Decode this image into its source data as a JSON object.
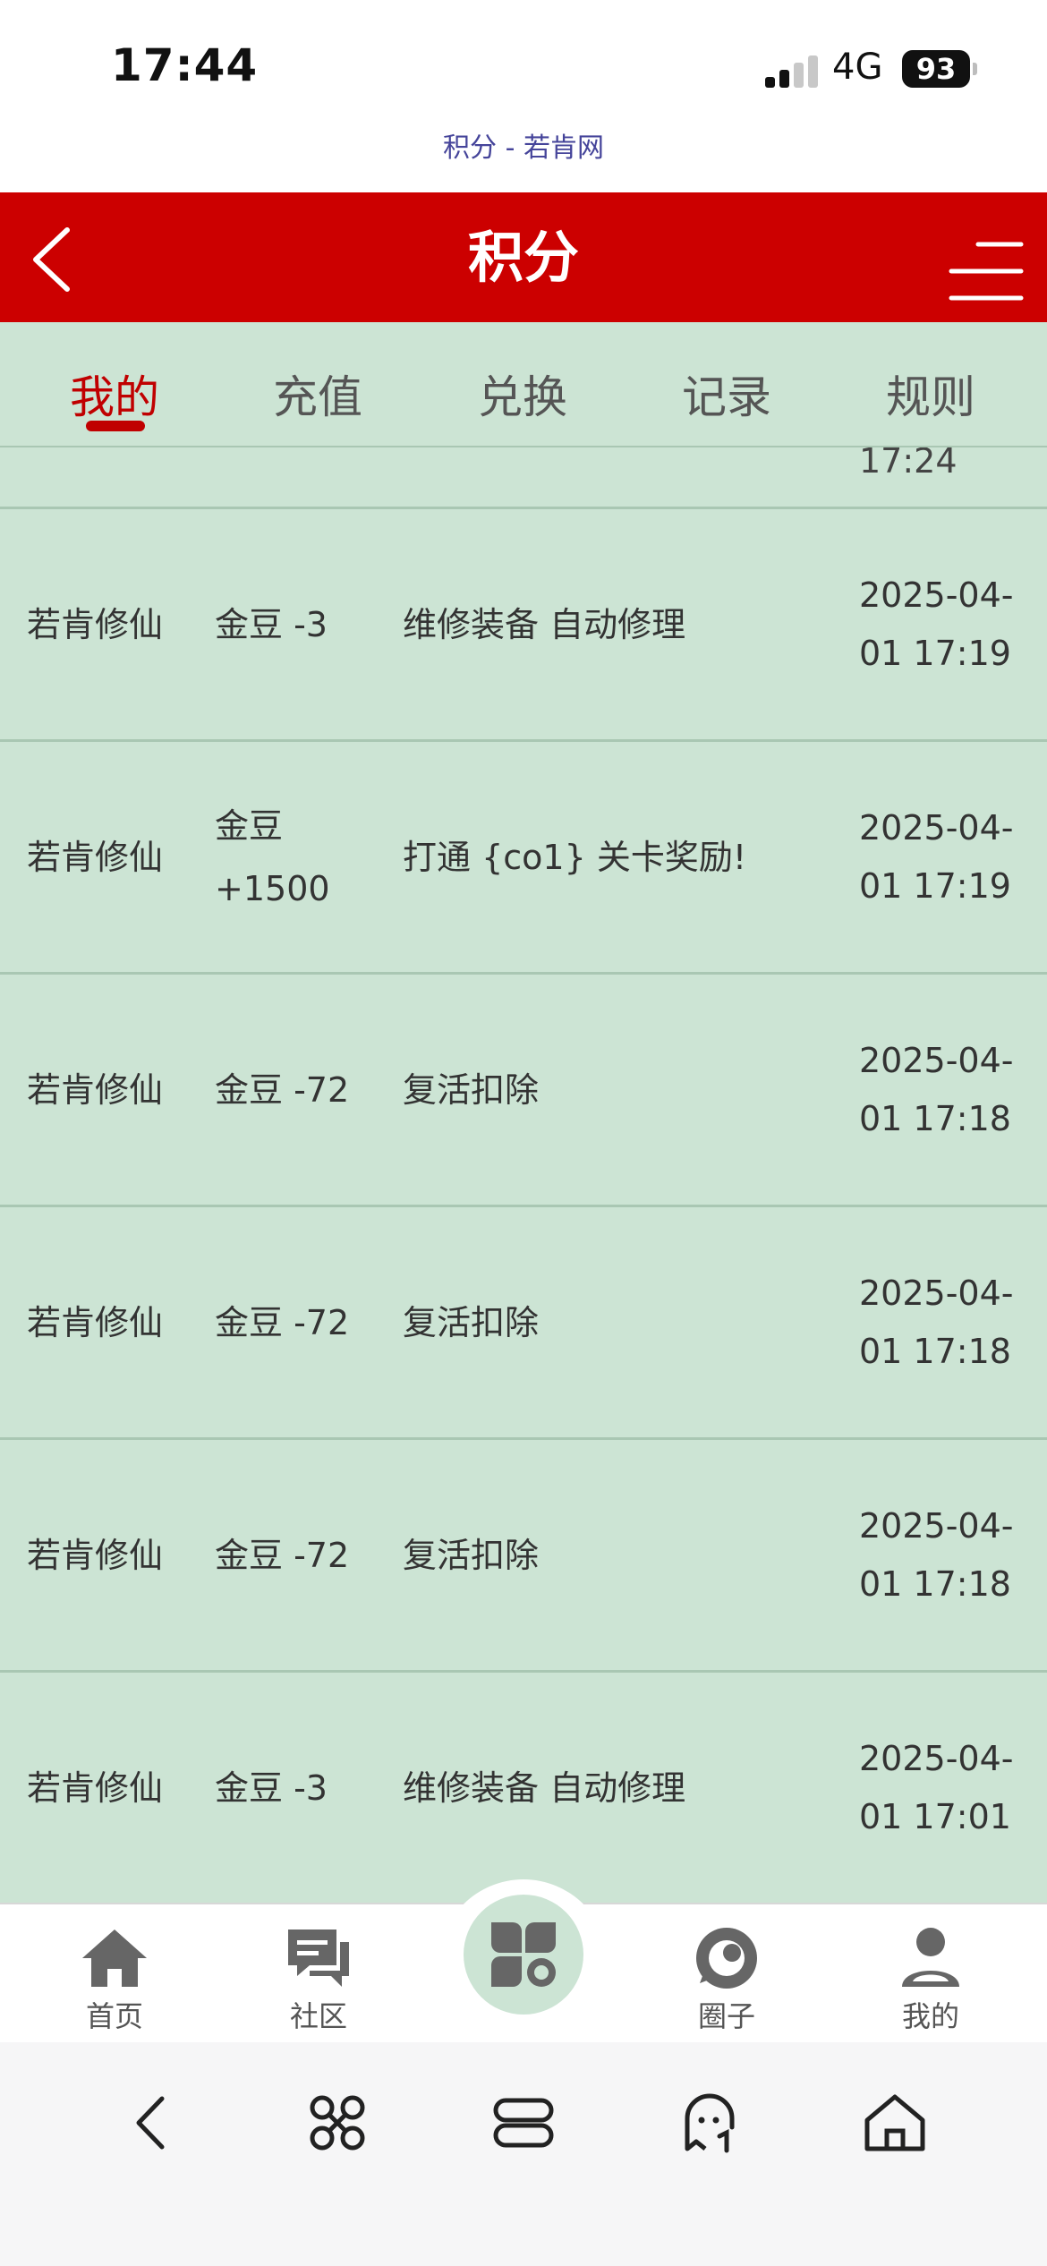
{
  "status_bar": {
    "time": "17:44",
    "network": "4G",
    "battery": "93"
  },
  "browser": {
    "page_title": "积分 - 若肯网"
  },
  "header": {
    "title": "积分",
    "back_icon": "chevron-left-icon",
    "menu_icon": "menu-icon"
  },
  "tabs": [
    {
      "label": "我的",
      "active": true
    },
    {
      "label": "充值",
      "active": false
    },
    {
      "label": "兑换",
      "active": false
    },
    {
      "label": "记录",
      "active": false
    },
    {
      "label": "规则",
      "active": false
    }
  ],
  "partial_row": {
    "time": "17:24"
  },
  "records": [
    {
      "user": "若肯修仙",
      "amount": "金豆 -3",
      "desc": "维修装备 自动修理",
      "time": "2025-04-01 17:19"
    },
    {
      "user": "若肯修仙",
      "amount": "金豆 +1500",
      "desc": "打通 {co1} 关卡奖励!",
      "time": "2025-04-01 17:19"
    },
    {
      "user": "若肯修仙",
      "amount": "金豆 -72",
      "desc": "复活扣除",
      "time": "2025-04-01 17:18"
    },
    {
      "user": "若肯修仙",
      "amount": "金豆 -72",
      "desc": "复活扣除",
      "time": "2025-04-01 17:18"
    },
    {
      "user": "若肯修仙",
      "amount": "金豆 -72",
      "desc": "复活扣除",
      "time": "2025-04-01 17:18"
    },
    {
      "user": "若肯修仙",
      "amount": "金豆 -3",
      "desc": "维修装备 自动修理",
      "time": "2025-04-01 17:01"
    }
  ],
  "bottom_nav": [
    {
      "label": "首页",
      "icon": "home-icon"
    },
    {
      "label": "社区",
      "icon": "chat-icon"
    },
    {
      "label": "",
      "icon": "apps-icon"
    },
    {
      "label": "圈子",
      "icon": "circle-icon"
    },
    {
      "label": "我的",
      "icon": "user-icon"
    }
  ],
  "browser_toolbar": [
    {
      "icon": "back-icon"
    },
    {
      "icon": "command-icon"
    },
    {
      "icon": "tabs-icon"
    },
    {
      "icon": "ghost-icon"
    },
    {
      "icon": "home-icon"
    }
  ],
  "colors": {
    "header": "#cc0000",
    "accent": "#c00000",
    "list_bg": "#cce4d4",
    "divider": "#a9c7b3"
  }
}
